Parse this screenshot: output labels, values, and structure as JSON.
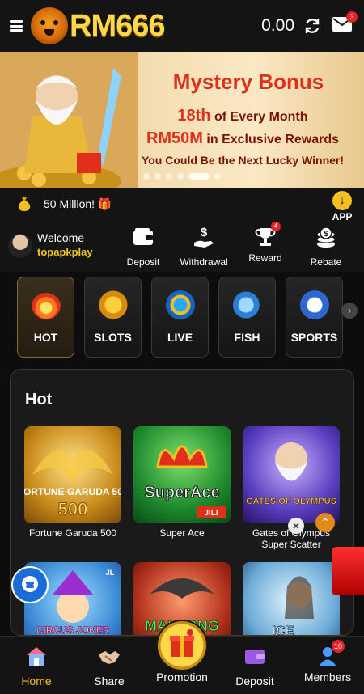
{
  "header": {
    "logo_text": "RM666",
    "balance": "0.00",
    "mail_badge": "3"
  },
  "banner": {
    "title": "Mystery Bonus",
    "line1_highlight": "18th",
    "line1_rest": " of Every Month",
    "line2_highlight": "RM50M",
    "line2_rest": " in Exclusive Rewards",
    "line3": "You Could Be the Next Lucky Winner!",
    "slide_count": 6,
    "active_slide": 5
  },
  "marquee": {
    "text": "50 Million! 🎁"
  },
  "app_button": {
    "label": "APP"
  },
  "user": {
    "welcome": "Welcome",
    "username": "topapkplay"
  },
  "actions": [
    {
      "label": "Deposit",
      "icon": "wallet-icon"
    },
    {
      "label": "Withdrawal",
      "icon": "dollar-hand-icon"
    },
    {
      "label": "Reward",
      "icon": "trophy-icon",
      "badge": "4"
    },
    {
      "label": "Rebate",
      "icon": "coins-icon"
    }
  ],
  "categories": [
    {
      "label": "HOT",
      "icon": "flame-icon",
      "active": true
    },
    {
      "label": "SLOTS",
      "icon": "slot-777-icon"
    },
    {
      "label": "LIVE",
      "icon": "poker-chip-icon"
    },
    {
      "label": "FISH",
      "icon": "fish-icon"
    },
    {
      "label": "SPORTS",
      "icon": "soccer-ball-icon"
    }
  ],
  "hot": {
    "title": "Hot",
    "games": [
      {
        "name": "Fortune Garuda 500",
        "thumb_text": "FORTUNE GARUDA 500"
      },
      {
        "name": "Super Ace",
        "thumb_text": "SuperAce",
        "tag": "JILI"
      },
      {
        "name": "Gates of Olympus Super Scatter",
        "thumb_text": "GATES OF OLYMPUS"
      },
      {
        "name": "",
        "thumb_text": "CIRCUS JOKER",
        "tag": "JL"
      },
      {
        "name": "",
        "thumb_text": "MAHJONG"
      },
      {
        "name": "",
        "thumb_text": "ICE"
      }
    ]
  },
  "bottom_nav": [
    {
      "label": "Home",
      "icon": "home-icon",
      "active": true
    },
    {
      "label": "Share",
      "icon": "handshake-icon"
    },
    {
      "label": "Promotion",
      "icon": "gift-icon"
    },
    {
      "label": "Deposit",
      "icon": "deposit-wallet-icon"
    },
    {
      "label": "Members",
      "icon": "members-icon",
      "badge": "10"
    }
  ],
  "colors": {
    "accent_gold": "#f3c11f",
    "badge_red": "#e3242b",
    "banner_title_red": "#e0301c",
    "background": "#0d0d0d"
  }
}
